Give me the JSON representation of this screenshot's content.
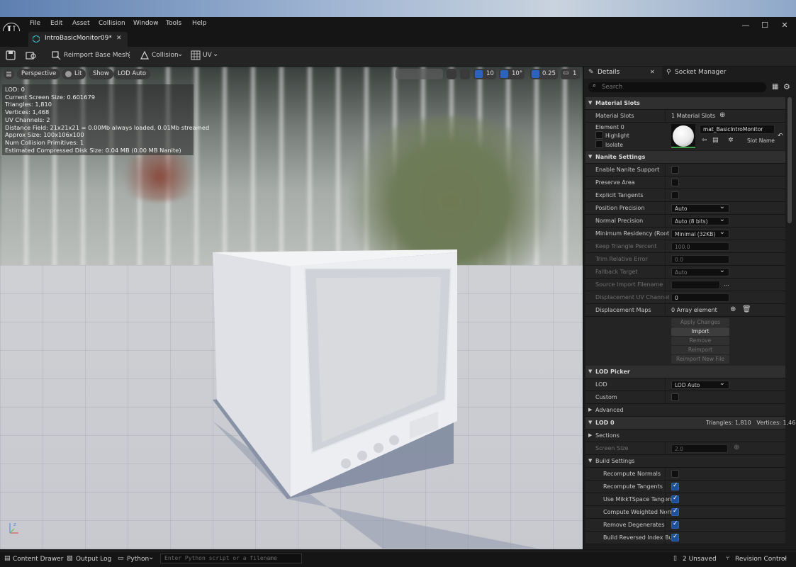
{
  "window": {
    "menu": [
      "File",
      "Edit",
      "Asset",
      "Collision",
      "Window",
      "Tools",
      "Help"
    ],
    "controls": {
      "minimize": "—",
      "maximize": "☐",
      "close": "✕"
    }
  },
  "tab": {
    "title": "IntroBasicMonitor09*",
    "close": "✕"
  },
  "toolbar": {
    "reimport": "Reimport Base Mesh",
    "collision": "Collision",
    "uv": "UV"
  },
  "viewport": {
    "buttons": {
      "perspective": "Perspective",
      "lit": "Lit",
      "show": "Show",
      "lod": "LOD Auto"
    },
    "right_values": {
      "grid": "10",
      "angle": "10°",
      "scale": "0.25",
      "camera": "1"
    },
    "stats": [
      "LOD: 0",
      "Current Screen Size: 0.601679",
      "Triangles: 1,810",
      "Vertices: 1,468",
      "UV Channels: 2",
      "Distance Field: 21x21x21 = 0.00Mb always loaded, 0.01Mb streamed",
      "Approx Size: 100x106x100",
      "Num Collision Primitives: 1",
      "Estimated Compressed Disk Size: 0.04 MB (0.00 MB Nanite)"
    ]
  },
  "details": {
    "tab_details": "Details",
    "tab_socket": "Socket Manager",
    "search_placeholder": "Search",
    "material_slots": {
      "header": "Material Slots",
      "label": "Material Slots",
      "count": "1 Material Slots",
      "element": "Element 0",
      "highlight": "Highlight",
      "isolate": "Isolate",
      "material_name": "mat_BasicIntroMonitor",
      "slot_name": "Slot Name"
    },
    "nanite": {
      "header": "Nanite Settings",
      "enable": "Enable Nanite Support",
      "preserve_area": "Preserve Area",
      "explicit_tangents": "Explicit Tangents",
      "position_precision": "Position Precision",
      "position_precision_value": "Auto",
      "normal_precision": "Normal Precision",
      "normal_precision_value": "Auto (8 bits)",
      "min_residency": "Minimum Residency (Root Ge",
      "min_residency_value": "Minimal (32KB)",
      "keep_triangle": "Keep Triangle Percent",
      "keep_triangle_value": "100.0",
      "trim_error": "Trim Relative Error",
      "trim_error_value": "0.0",
      "fallback_target": "Fallback Target",
      "fallback_target_value": "Auto",
      "source_import": "Source Import Filename",
      "source_import_more": "...",
      "displacement_uv": "Displacement UV Channel",
      "displacement_uv_value": "0",
      "displacement_maps": "Displacement Maps",
      "displacement_maps_value": "0 Array element",
      "buttons": [
        "Apply Changes",
        "Import",
        "Remove",
        "Reimport",
        "Reimport New File"
      ]
    },
    "lod_picker": {
      "header": "LOD Picker",
      "lod": "LOD",
      "lod_value": "LOD Auto",
      "custom": "Custom",
      "advanced": "Advanced"
    },
    "lod0": {
      "header": "LOD 0",
      "summary": "Triangles: 1,810   Vertices: 1,468",
      "sections": "Sections",
      "screen_size": "Screen Size",
      "screen_size_value": "2.0",
      "build_settings": "Build Settings",
      "recompute_normals": "Recompute Normals",
      "recompute_tangents": "Recompute Tangents",
      "mikkt": "Use MikkTSpace Tangent",
      "weighted": "Compute Weighted Norma",
      "degenerates": "Remove Degenerates",
      "reversed": "Build Reversed Index Buff"
    }
  },
  "statusbar": {
    "content_drawer": "Content Drawer",
    "output_log": "Output Log",
    "python": "Python",
    "console_placeholder": "Enter Python script or a filename",
    "unsaved": "2 Unsaved",
    "revision": "Revision Control"
  },
  "colors": {
    "accent": "#2b63bd",
    "panel": "#242424",
    "bg": "#151515"
  }
}
